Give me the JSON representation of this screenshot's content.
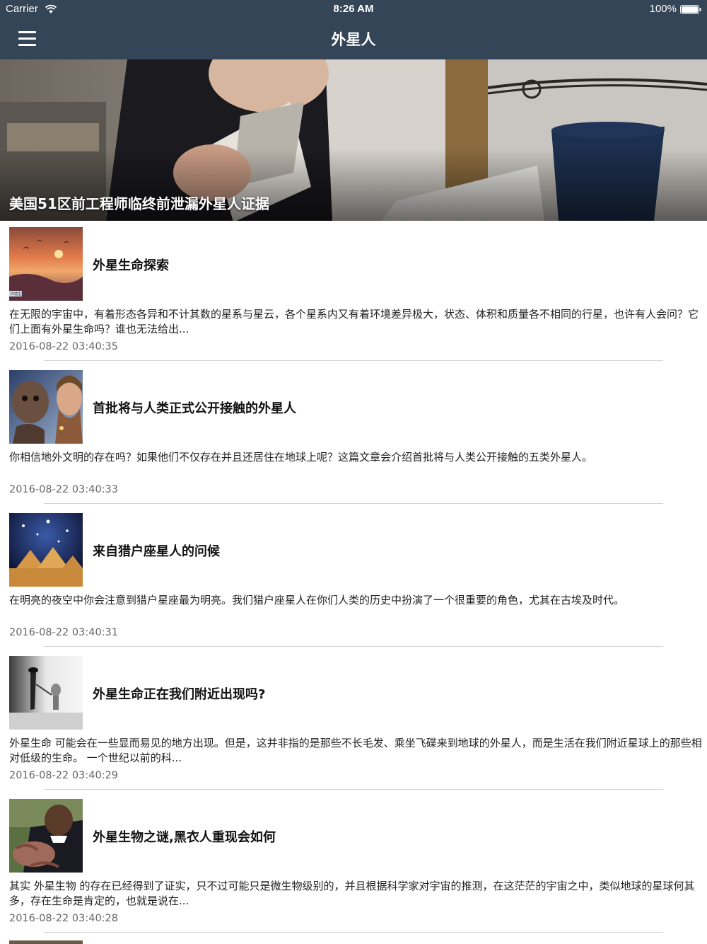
{
  "status_bar": {
    "carrier": "Carrier",
    "time": "8:26 AM",
    "battery": "100%"
  },
  "nav": {
    "title": "外星人",
    "menu_icon": "hamburger-menu-icon"
  },
  "hero": {
    "caption": "美国51区前工程师临终前泄漏外星人证据"
  },
  "articles": [
    {
      "title": "外星生命探索",
      "summary": "在无限的宇宙中，有着形态各异和不计其数的星系与星云，各个星系内又有着环境差异极大，状态、体积和质量各不相同的行星，也许有人会问？它们上面有外星生命吗？谁也无法给出...",
      "date": "2016-08-22 03:40:35",
      "thumb_badge": "环境生态"
    },
    {
      "title": "首批将与人类正式公开接触的外星人",
      "summary": "你相信地外文明的存在吗？如果他们不仅存在并且还居住在地球上呢？这篇文章会介绍首批将与人类公开接触的五类外星人。",
      "date": "2016-08-22 03:40:33"
    },
    {
      "title": "来自猎户座星人的问候",
      "summary": "在明亮的夜空中你会注意到猎户星座最为明亮。我们猎户座星人在你们人类的历史中扮演了一个很重要的角色，尤其在古埃及时代。",
      "date": "2016-08-22 03:40:31"
    },
    {
      "title": "外星生命正在我们附近出现吗?",
      "summary": "外星生命 可能会在一些显而易见的地方出现。但是，这并非指的是那些不长毛发、乘坐飞碟来到地球的外星人，而是生活在我们附近星球上的那些相对低级的生命。 一个世纪以前的科...",
      "date": "2016-08-22 03:40:29"
    },
    {
      "title": "外星生物之谜,黑衣人重现会如何",
      "summary": "其实 外星生物 的存在已经得到了证实，只不过可能只是微生物级别的，并且根据科学家对宇宙的推测，在这茫茫的宇宙之中，类似地球的星球何其多，存在生命是肯定的，也就是说在...",
      "date": "2016-08-22 03:40:28"
    }
  ],
  "colors": {
    "nav_bg": "#334556",
    "divider": "#d4d4d4",
    "date_text": "#666666"
  }
}
